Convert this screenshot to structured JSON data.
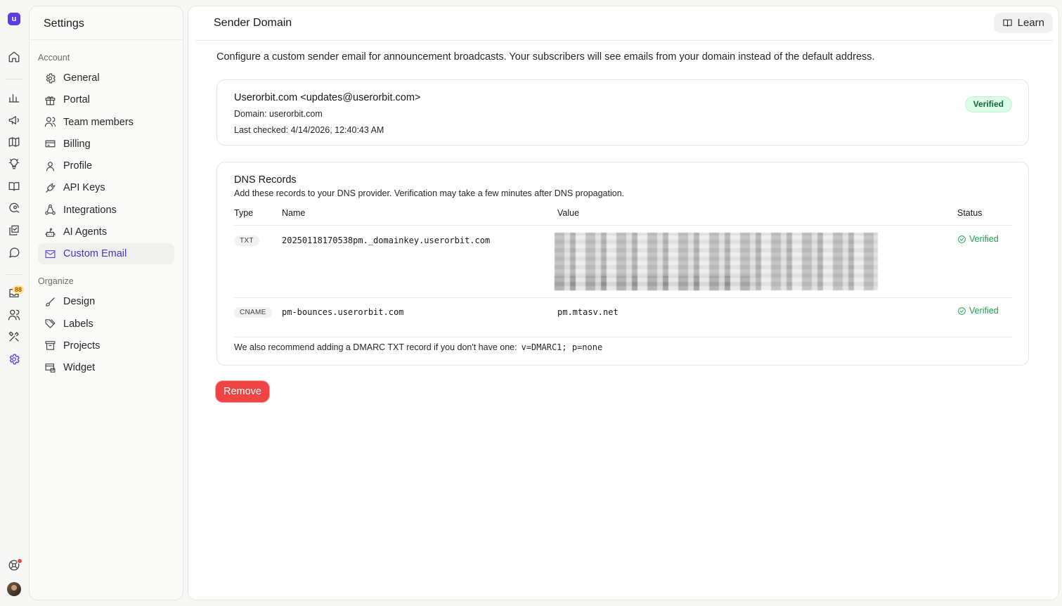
{
  "rail": {
    "logo_letter": "u",
    "notification_count": "88",
    "items": [
      "home-icon",
      "chart-icon",
      "megaphone-icon",
      "map-icon",
      "lightbulb-icon",
      "book-icon",
      "search-chat-icon",
      "check-square-icon",
      "chat-icon",
      "inbox-icon",
      "users-icon",
      "tools-icon",
      "gear-icon",
      "support-icon",
      "avatar"
    ]
  },
  "sidebar": {
    "title": "Settings",
    "account_label": "Account",
    "organize_label": "Organize",
    "account_items": [
      {
        "label": "General",
        "icon": "gear-icon"
      },
      {
        "label": "Portal",
        "icon": "gift-icon"
      },
      {
        "label": "Team members",
        "icon": "users-icon"
      },
      {
        "label": "Billing",
        "icon": "credit-card-icon"
      },
      {
        "label": "Profile",
        "icon": "user-icon"
      },
      {
        "label": "API Keys",
        "icon": "plug-icon"
      },
      {
        "label": "Integrations",
        "icon": "integrations-icon"
      },
      {
        "label": "AI Agents",
        "icon": "robot-icon"
      },
      {
        "label": "Custom Email",
        "icon": "mail-icon"
      }
    ],
    "organize_items": [
      {
        "label": "Design",
        "icon": "brush-icon"
      },
      {
        "label": "Labels",
        "icon": "tag-icon"
      },
      {
        "label": "Projects",
        "icon": "archive-icon"
      },
      {
        "label": "Widget",
        "icon": "widget-icon"
      }
    ],
    "active_item": "Custom Email"
  },
  "header": {
    "title": "Sender Domain",
    "learn_label": "Learn"
  },
  "intro": "Configure a custom sender email for announcement broadcasts. Your subscribers will see emails from your domain instead of the default address.",
  "sender": {
    "name": "Userorbit.com <updates@userorbit.com>",
    "domain_line": "Domain: userorbit.com",
    "checked_line": "Last checked: 4/14/2026, 12:40:43 AM",
    "status": "Verified"
  },
  "dns": {
    "title": "DNS Records",
    "subtitle": "Add these records to your DNS provider. Verification may take a few minutes after DNS propagation.",
    "columns": [
      "Type",
      "Name",
      "Value",
      "Status"
    ],
    "rows": [
      {
        "type": "TXT",
        "name": "20250118170538pm._domainkey.userorbit.com",
        "value": "",
        "status": "Verified"
      },
      {
        "type": "CNAME",
        "name": "pm-bounces.userorbit.com",
        "value": "pm.mtasv.net",
        "status": "Verified"
      }
    ],
    "dmarc_text": "We also recommend adding a DMARC TXT record if you don't have one:",
    "dmarc_code": "v=DMARC1; p=none"
  },
  "remove_label": "Remove",
  "colors": {
    "accent": "#5b3de3",
    "danger": "#ef4444",
    "success": "#16a34a"
  }
}
